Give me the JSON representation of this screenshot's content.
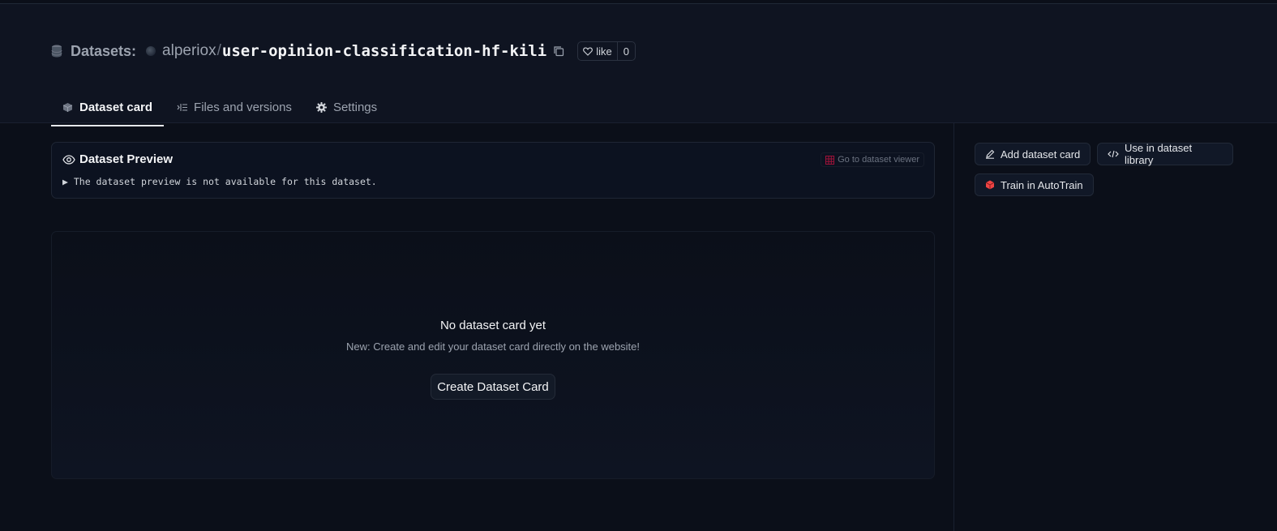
{
  "header": {
    "section_label": "Datasets:",
    "owner": "alperiox",
    "separator": "/",
    "repo_name": "user-opinion-classification-hf-kili",
    "like_label": "like",
    "like_count": "0"
  },
  "tabs": [
    {
      "label": "Dataset card",
      "icon": "cube-icon",
      "active": true
    },
    {
      "label": "Files and versions",
      "icon": "files-icon",
      "active": false
    },
    {
      "label": "Settings",
      "icon": "gear-icon",
      "active": false
    }
  ],
  "preview": {
    "title": "Dataset Preview",
    "viewer_link": "Go to dataset viewer",
    "message": "The dataset preview is not available for this dataset."
  },
  "card": {
    "title": "No dataset card yet",
    "subtitle": "New: Create and edit your dataset card directly on the website!",
    "create_button": "Create Dataset Card"
  },
  "sidebar": {
    "buttons": [
      {
        "label": "Add dataset card",
        "icon": "pencil-icon"
      },
      {
        "label": "Use in dataset library",
        "icon": "code-icon"
      },
      {
        "label": "Train in AutoTrain",
        "icon": "autotrain-icon"
      }
    ]
  },
  "colors": {
    "background": "#0b0f19",
    "header_bg": "#0f1421",
    "autotrain_accent": "#ef4444",
    "viewer_icon": "#9f1239"
  }
}
